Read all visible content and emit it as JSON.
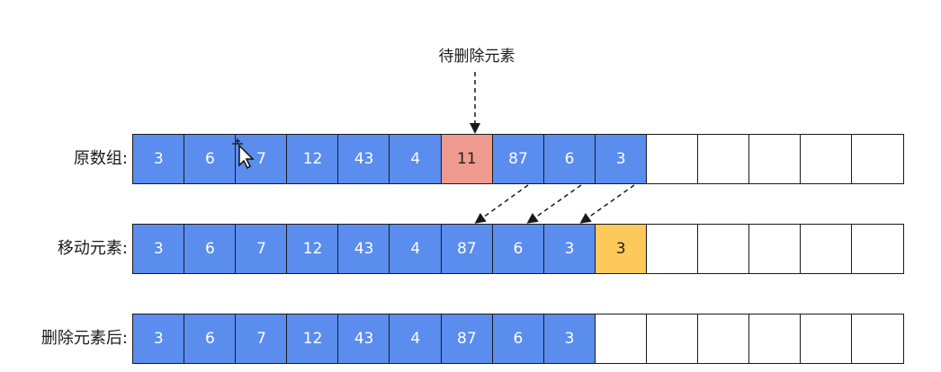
{
  "annotation": {
    "pending_delete_label": "待删除元素"
  },
  "rows": [
    {
      "label": "原数组:",
      "cells": [
        "3",
        "6",
        "7",
        "12",
        "43",
        "4",
        "11",
        "87",
        "6",
        "3",
        "",
        "",
        "",
        "",
        ""
      ],
      "highlight": {
        "6": "target"
      }
    },
    {
      "label": "移动元素:",
      "cells": [
        "3",
        "6",
        "7",
        "12",
        "43",
        "4",
        "87",
        "6",
        "3",
        "3",
        "",
        "",
        "",
        "",
        ""
      ],
      "highlight": {
        "9": "dup"
      }
    },
    {
      "label": "删除元素后:",
      "cells": [
        "3",
        "6",
        "7",
        "12",
        "43",
        "4",
        "87",
        "6",
        "3",
        "",
        "",
        "",
        "",
        "",
        ""
      ],
      "highlight": {}
    }
  ],
  "colors": {
    "filled": "#5b8def",
    "target": "#ee9a8f",
    "duplicate": "#fcc95a",
    "border": "#1a1a1a"
  },
  "icons": {
    "cursor": "move-cursor-icon"
  }
}
